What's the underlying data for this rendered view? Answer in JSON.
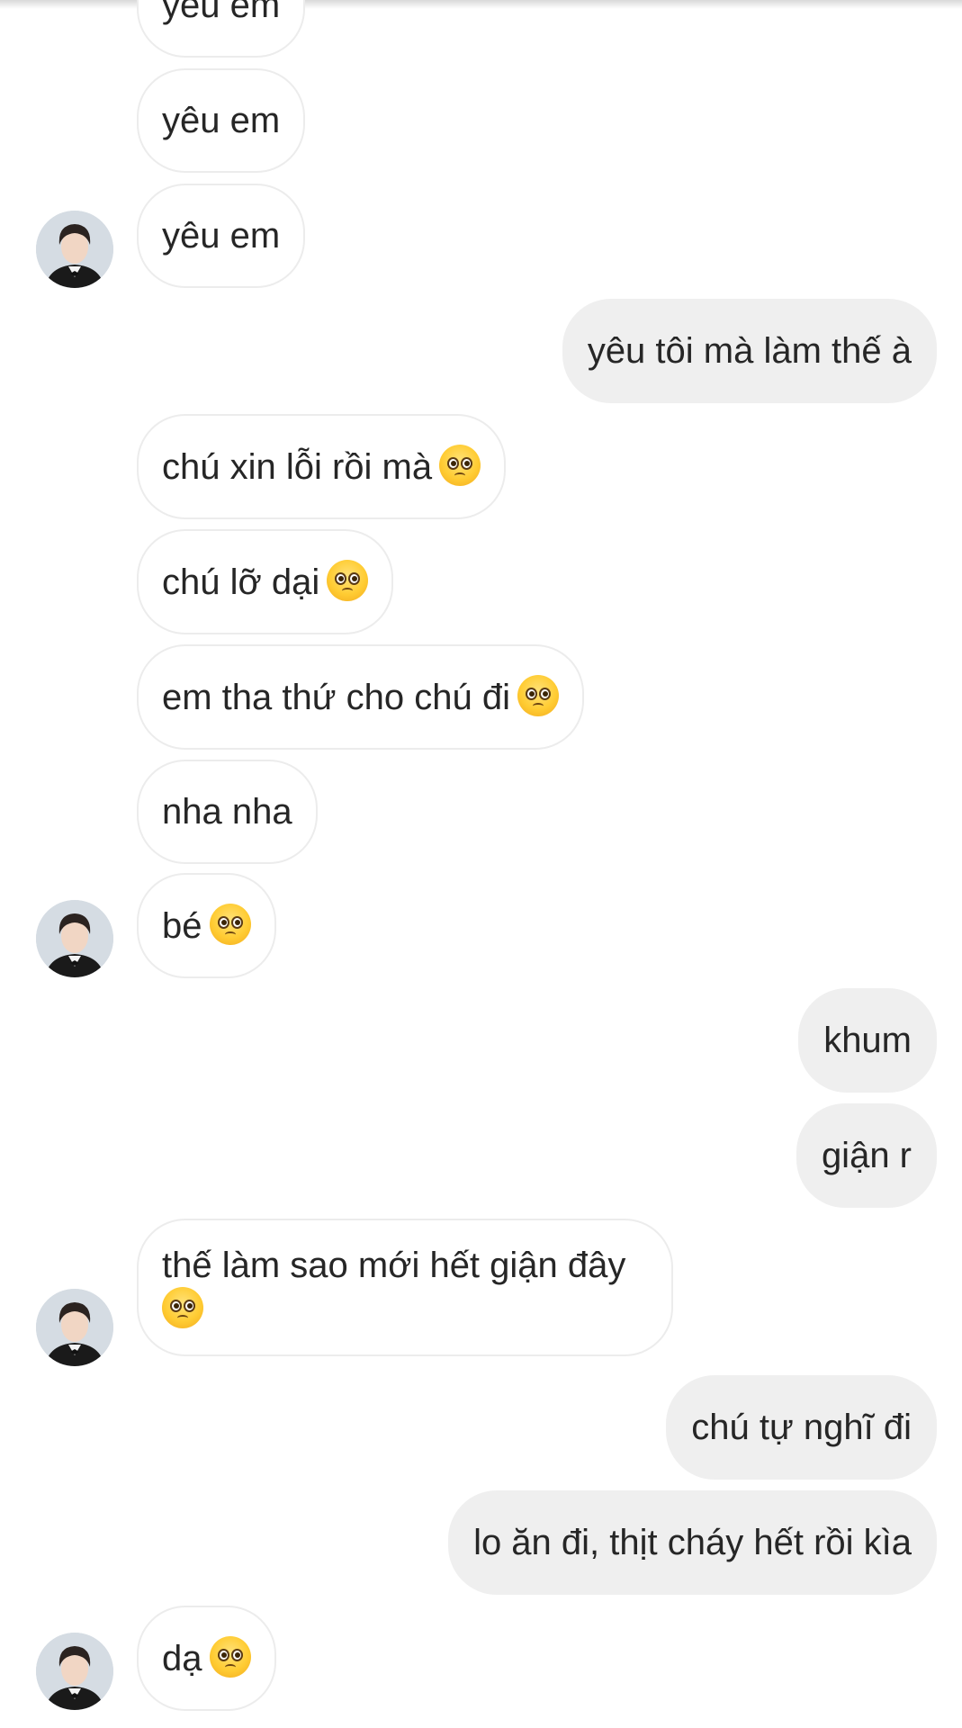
{
  "conversation": {
    "messages": [
      {
        "side": "in",
        "text": "yêu em",
        "emoji": false
      },
      {
        "side": "in",
        "text": "yêu em",
        "emoji": false
      },
      {
        "side": "in",
        "text": "yêu em",
        "emoji": false,
        "avatar": true
      },
      {
        "side": "out",
        "text": "yêu tôi mà làm thế à",
        "emoji": false
      },
      {
        "side": "in",
        "text": "chú xin lỗi rồi mà",
        "emoji": true
      },
      {
        "side": "in",
        "text": "chú lỡ dại",
        "emoji": true
      },
      {
        "side": "in",
        "text": "em tha thứ cho chú đi",
        "emoji": true
      },
      {
        "side": "in",
        "text": "nha nha",
        "emoji": false
      },
      {
        "side": "in",
        "text": "bé",
        "emoji": true,
        "avatar": true
      },
      {
        "side": "out",
        "text": "khum",
        "emoji": false
      },
      {
        "side": "out",
        "text": "giận r",
        "emoji": false
      },
      {
        "side": "in",
        "text": "thế làm sao mới hết giận đây",
        "emoji": true,
        "avatar": true
      },
      {
        "side": "out",
        "text": "chú tự nghĩ đi",
        "emoji": false
      },
      {
        "side": "out",
        "text": "lo ăn đi, thịt cháy hết rồi kìa",
        "emoji": false
      },
      {
        "side": "in",
        "text": "dạ",
        "emoji": true,
        "avatar": true
      }
    ],
    "emoji_name": "pleading-face-emoji",
    "colors": {
      "incoming_bubble": "#ffffff",
      "incoming_border": "#ececec",
      "outgoing_bubble": "#efefef",
      "text": "#262626"
    }
  }
}
